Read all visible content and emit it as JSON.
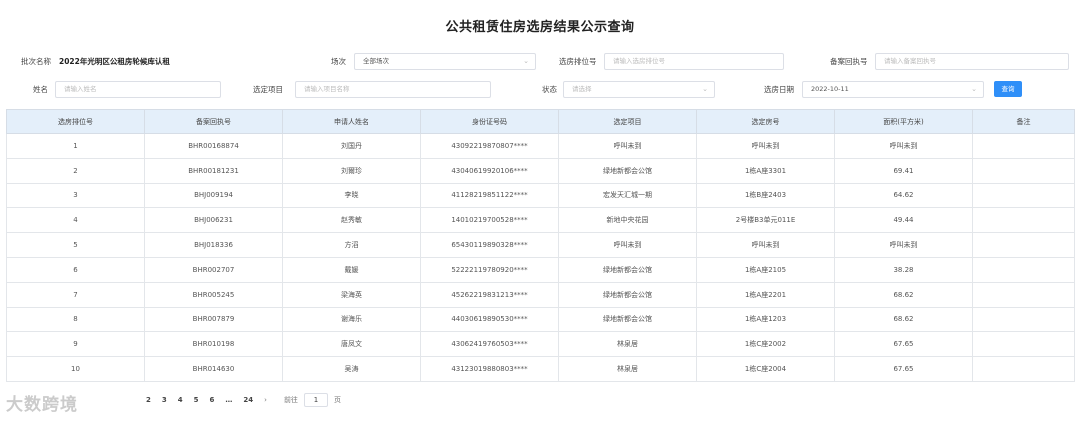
{
  "title": "公共租赁住房选房结果公示查询",
  "filters": {
    "batch_label": "批次名称",
    "batch_value": "2022年光明区公租房轮候库认租",
    "session_label": "场次",
    "session_value": "全部场次",
    "rank_label": "选房排位号",
    "rank_placeholder": "请输入选房排位号",
    "receipt_label": "备案回执号",
    "receipt_placeholder": "请输入备案回执号",
    "name_label": "姓名",
    "name_placeholder": "请输入姓名",
    "project_label": "选定项目",
    "project_placeholder": "请输入项目名称",
    "status_label": "状态",
    "status_placeholder": "请选择",
    "date_label": "选房日期",
    "date_value": "2022-10-11",
    "query_button": "查询"
  },
  "table": {
    "columns": [
      "选房排位号",
      "备案回执号",
      "申请人姓名",
      "身份证号码",
      "选定项目",
      "选定房号",
      "面积(平方米)",
      "备注"
    ],
    "rows": [
      [
        "1",
        "BHR00168874",
        "刘国丹",
        "43092219870807****",
        "呼叫未到",
        "呼叫未到",
        "呼叫未到",
        ""
      ],
      [
        "2",
        "BHR00181231",
        "刘爾珍",
        "43040619920106****",
        "绿地新都会公馆",
        "1栋A座3301",
        "69.41",
        ""
      ],
      [
        "3",
        "BHJ009194",
        "李晓",
        "41128219851122****",
        "宏发天汇城一期",
        "1栋B座2403",
        "64.62",
        ""
      ],
      [
        "4",
        "BHJ006231",
        "赵秀敏",
        "14010219700528****",
        "新地中央花园",
        "2号楼B3单元011E",
        "49.44",
        ""
      ],
      [
        "5",
        "BHJ018336",
        "方滔",
        "65430119890328****",
        "呼叫未到",
        "呼叫未到",
        "呼叫未到",
        ""
      ],
      [
        "6",
        "BHR002707",
        "戴媛",
        "52222119780920****",
        "绿地新都会公馆",
        "1栋A座2105",
        "38.28",
        ""
      ],
      [
        "7",
        "BHR005245",
        "梁海英",
        "45262219831213****",
        "绿地新都会公馆",
        "1栋A座2201",
        "68.62",
        ""
      ],
      [
        "8",
        "BHR007879",
        "谢海乐",
        "44030619890530****",
        "绿地新都会公馆",
        "1栋A座1203",
        "68.62",
        ""
      ],
      [
        "9",
        "BHR010198",
        "唐凤文",
        "43062419760503****",
        "林泉居",
        "1栋C座2002",
        "67.65",
        ""
      ],
      [
        "10",
        "BHR014630",
        "吴涛",
        "43123019880803****",
        "林泉居",
        "1栋C座2004",
        "67.65",
        ""
      ]
    ]
  },
  "pagination": {
    "pages": [
      "2",
      "3",
      "4",
      "5",
      "6",
      "…",
      "24"
    ],
    "next": "›",
    "goto_label": "前往",
    "goto_value": "1",
    "page_unit": "页"
  },
  "watermark": "大数跨境"
}
